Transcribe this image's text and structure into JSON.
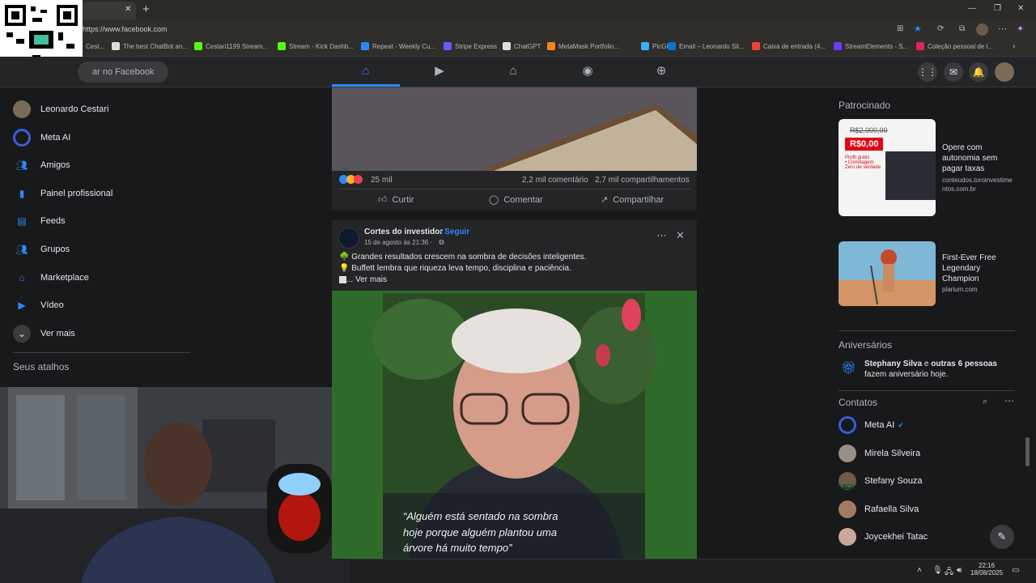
{
  "browser": {
    "url": "https://www.facebook.com",
    "tab_close": "✕",
    "new_tab": "+",
    "bookmarks": [
      {
        "label": "Cest...",
        "color": "#555"
      },
      {
        "label": "The best ChatBot an...",
        "color": "#ddd"
      },
      {
        "label": "Cestari1199 Stream...",
        "color": "#53fc18"
      },
      {
        "label": "Stream - Kick Dashb...",
        "color": "#53fc18"
      },
      {
        "label": "Repeat - Weekly Cu...",
        "color": "#2d88ff"
      },
      {
        "label": "Stripe Express",
        "color": "#635bff"
      },
      {
        "label": "ChatGPT",
        "color": "#ddd"
      },
      {
        "label": "MetaMask Portfolio...",
        "color": "#f6851b"
      },
      {
        "label": "PicGG",
        "color": "#3ab0ff"
      },
      {
        "label": "Email – Leonardo Sil...",
        "color": "#0078d4"
      },
      {
        "label": "Caixa de entrada (4...",
        "color": "#ea4335"
      },
      {
        "label": "StreamElements - S...",
        "color": "#6b3bff"
      },
      {
        "label": "Coleção pessoal de l...",
        "color": "#e0245e"
      }
    ]
  },
  "fb_header": {
    "search_placeholder": "ar no Facebook"
  },
  "left_nav": {
    "items": [
      {
        "label": "Leonardo Cestari",
        "icon": "profile-avatar",
        "color": "#7a6a5a"
      },
      {
        "label": "Meta AI",
        "icon": "meta-ai-icon",
        "color": "#3b5bdb"
      },
      {
        "label": "Amigos",
        "icon": "friends-icon",
        "color": "#2d88ff"
      },
      {
        "label": "Painel profissional",
        "icon": "dashboard-icon",
        "color": "#2d88ff"
      },
      {
        "label": "Feeds",
        "icon": "feeds-icon",
        "color": "#2d88ff"
      },
      {
        "label": "Grupos",
        "icon": "groups-icon",
        "color": "#2d88ff"
      },
      {
        "label": "Marketplace",
        "icon": "marketplace-icon",
        "color": "#2d88ff"
      },
      {
        "label": "Vídeo",
        "icon": "video-icon",
        "color": "#2d88ff"
      },
      {
        "label": "Ver mais",
        "icon": "chevron-down-icon",
        "color": "#3a3b3c"
      }
    ],
    "shortcuts_title": "Seus atalhos"
  },
  "feed": {
    "post1": {
      "reactions_count": "25 mil",
      "comments": "2,2 mil comentário",
      "shares": "2,7 mil compartilhamentos",
      "like": "Curtir",
      "comment": "Comentar",
      "share": "Compartilhar"
    },
    "post2": {
      "author": "Cortes do investidor",
      "follow": "· Seguir",
      "date": "15 de agosto às 21:36 ·",
      "line1": "🌳 Grandes resultados crescem na sombra de decisões inteligentes.",
      "line2": "💡 Buffett lembra que riqueza leva tempo, disciplina e paciência.",
      "more": "... Ver mais",
      "caption1": "“Alguém está sentado na sombra",
      "caption2": "hoje porque alguém plantou uma",
      "caption3": "árvore há muito tempo”"
    }
  },
  "right": {
    "sponsored_title": "Patrocinado",
    "ad1": {
      "title": "Opere com autonomia sem pagar taxas",
      "domain": "conteudos.toroinvestimentos.com.br",
      "price_old": "R$2.000,00",
      "price_new": "R$0,00",
      "bullets": "Profit grátis\n• Corretagem\nZero de verdade"
    },
    "ad2": {
      "title": "First-Ever Free Legendary Champion",
      "domain": "plarium.com"
    },
    "birthdays_title": "Aniversários",
    "birthday_name": "Stephany Silva",
    "birthday_rest": " e ",
    "birthday_others": "outras 6 pessoas",
    "birthday_end": " fazem aniversário hoje.",
    "contacts_title": "Contatos",
    "contacts": [
      {
        "name": "Meta AI",
        "color": "#3b5bdb",
        "badge": ""
      },
      {
        "name": "Mirela Silveira",
        "color": "#9a8d84",
        "badge": ""
      },
      {
        "name": "Stefany Souza",
        "color": "#6d5a4c",
        "badge": "4 min"
      },
      {
        "name": "Rafaella Silva",
        "color": "#a27b63",
        "badge": ""
      },
      {
        "name": "Joycekhei Tatac",
        "color": "#c9a79a",
        "badge": ""
      }
    ]
  },
  "taskbar": {
    "time": "22:16",
    "date": "18/08/2025"
  }
}
